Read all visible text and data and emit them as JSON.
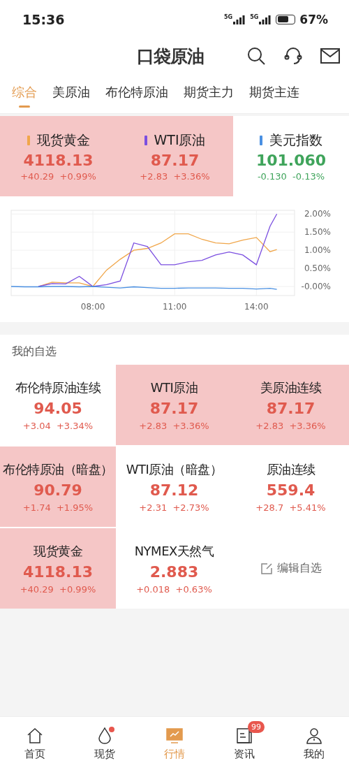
{
  "status_bar": {
    "time": "15:36",
    "signals": [
      "5G",
      "5G"
    ],
    "battery": "67%"
  },
  "header": {
    "logo": "口袋原油"
  },
  "tabs": [
    {
      "label": "综合",
      "selected": true
    },
    {
      "label": "美原油",
      "selected": false
    },
    {
      "label": "布伦特原油",
      "selected": false
    },
    {
      "label": "期货主力",
      "selected": false
    },
    {
      "label": "期货主连",
      "selected": false
    }
  ],
  "quotes": [
    {
      "name": "现货黄金",
      "color": "#f0a64a",
      "price": "4118.13",
      "change": "+40.29",
      "percent": "+0.99%",
      "kind": "up",
      "highlighted": true
    },
    {
      "name": "WTI原油",
      "color": "#7b4fe0",
      "price": "87.17",
      "change": "+2.83",
      "percent": "+3.36%",
      "kind": "up",
      "highlighted": true
    },
    {
      "name": "美元指数",
      "color": "#4a90e2",
      "price": "101.060",
      "change": "-0.130",
      "percent": "-0.13%",
      "kind": "down",
      "highlighted": false
    }
  ],
  "chart_data": {
    "type": "line",
    "grid": true,
    "x": [
      5,
      5.5,
      6,
      6.5,
      7,
      7.5,
      8,
      8.5,
      9,
      9.5,
      10,
      10.5,
      11,
      11.5,
      12,
      12.5,
      13,
      13.5,
      14,
      14.5,
      14.75
    ],
    "xlim": [
      5,
      15.4
    ],
    "ylim": [
      -0.25,
      2.1
    ],
    "xticks": [
      {
        "value": 8,
        "label": "08:00"
      },
      {
        "value": 11,
        "label": "11:00"
      },
      {
        "value": 14,
        "label": "14:00"
      }
    ],
    "yticks": [
      {
        "value": 2,
        "label": "2.00%"
      },
      {
        "value": 1.5,
        "label": "1.50%"
      },
      {
        "value": 1,
        "label": "1.00%"
      },
      {
        "value": 0.5,
        "label": "0.50%"
      },
      {
        "value": 0,
        "label": "-0.00%"
      }
    ],
    "series": [
      {
        "color": "#f0a64a",
        "values": [
          null,
          null,
          0,
          0.12,
          0.1,
          0.1,
          0,
          0.45,
          0.75,
          1.0,
          1.05,
          1.2,
          1.45,
          1.45,
          1.3,
          1.2,
          1.18,
          1.28,
          1.35,
          0.96,
          1.02
        ]
      },
      {
        "color": "#7b4fe0",
        "values": [
          null,
          null,
          0,
          0.08,
          0.07,
          0.28,
          0,
          0.05,
          0.15,
          1.2,
          1.1,
          0.6,
          0.6,
          0.68,
          0.72,
          0.87,
          0.95,
          0.87,
          0.6,
          1.66,
          2.0
        ]
      },
      {
        "color": "#4a90e2",
        "values": [
          0,
          -0.01,
          -0.01,
          0,
          0,
          -0.01,
          0,
          -0.02,
          -0.04,
          -0.01,
          -0.03,
          -0.05,
          -0.05,
          -0.04,
          -0.04,
          -0.04,
          -0.05,
          -0.05,
          -0.07,
          -0.05,
          -0.08
        ]
      }
    ]
  },
  "watchlist": {
    "title": "我的自选",
    "items": [
      {
        "name": "布伦特原油连续",
        "price": "94.05",
        "change": "+3.04",
        "percent": "+3.34%",
        "highlighted": false
      },
      {
        "name": "WTI原油",
        "price": "87.17",
        "change": "+2.83",
        "percent": "+3.36%",
        "highlighted": true
      },
      {
        "name": "美原油连续",
        "price": "87.17",
        "change": "+2.83",
        "percent": "+3.36%",
        "highlighted": true
      },
      {
        "name": "布伦特原油（暗盘）",
        "price": "90.79",
        "change": "+1.74",
        "percent": "+1.95%",
        "highlighted": true
      },
      {
        "name": "WTI原油（暗盘）",
        "price": "87.12",
        "change": "+2.31",
        "percent": "+2.73%",
        "highlighted": false
      },
      {
        "name": "原油连续",
        "price": "559.4",
        "change": "+28.7",
        "percent": "+5.41%",
        "highlighted": false
      },
      {
        "name": "现货黄金",
        "price": "4118.13",
        "change": "+40.29",
        "percent": "+0.99%",
        "highlighted": true
      },
      {
        "name": "NYMEX天然气",
        "price": "2.883",
        "change": "+0.018",
        "percent": "+0.63%",
        "highlighted": false
      }
    ],
    "edit_button": "编辑自选"
  },
  "bottom_nav": [
    {
      "label": "首页",
      "kind": "home",
      "selected": false,
      "dot": false
    },
    {
      "label": "现货",
      "kind": "drop",
      "selected": false,
      "dot": true
    },
    {
      "label": "行情",
      "kind": "monitor",
      "selected": true,
      "dot": false
    },
    {
      "label": "资讯",
      "kind": "news",
      "selected": false,
      "dot": false,
      "badge": "99"
    },
    {
      "label": "我的",
      "kind": "user",
      "selected": false,
      "dot": false
    }
  ]
}
